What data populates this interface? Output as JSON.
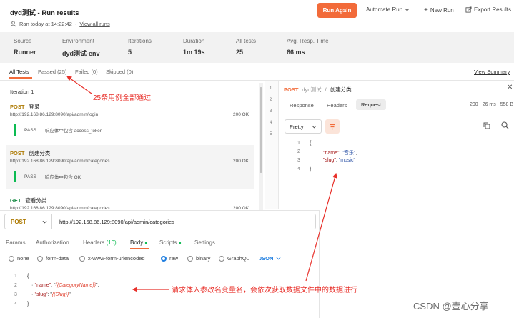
{
  "header": {
    "title": "dyd测试 - Run results",
    "ran_text": "Ran today at 14:22:42",
    "view_all_runs": "View all runs",
    "run_again": "Run Again",
    "automate_run": "Automate Run",
    "new_run": "New Run",
    "export_results": "Export Results"
  },
  "stats": [
    {
      "label": "Source",
      "value": "Runner"
    },
    {
      "label": "Environment",
      "value": "dyd测试-env"
    },
    {
      "label": "Iterations",
      "value": "5"
    },
    {
      "label": "Duration",
      "value": "1m 19s"
    },
    {
      "label": "All tests",
      "value": "25"
    },
    {
      "label": "Avg. Resp. Time",
      "value": "66 ms"
    }
  ],
  "tabs": {
    "all": "All Tests",
    "passed": "Passed (25)",
    "failed": "Failed (0)",
    "skipped": "Skipped (0)",
    "view_summary": "View Summary"
  },
  "results": {
    "iteration": "Iteration 1",
    "items": [
      {
        "method": "POST",
        "name": "登录",
        "url": "http://192.168.86.129:8090/api/admin/login",
        "status": "200 OK",
        "pass": "PASS",
        "test": "响应体中包含 access_token"
      },
      {
        "method": "POST",
        "name": "创建分类",
        "url": "http://192.168.86.129:8090/api/admin/categories",
        "status": "200 OK",
        "pass": "PASS",
        "test": "响应体中包含 OK"
      },
      {
        "method": "GET",
        "name": "查看分类",
        "url": "http://192.168.86.129:8090/api/admin/categories",
        "status": "200 OK"
      }
    ]
  },
  "right_panel": {
    "gutter": [
      "1",
      "2",
      "3",
      "4",
      "5"
    ],
    "method": "POST",
    "collection": "dyd测试",
    "separator": "/",
    "request_name": "创建分类",
    "tabs": [
      "Response",
      "Headers",
      "Request"
    ],
    "status": "200",
    "time": "26 ms",
    "size": "558 B",
    "format": "Pretty",
    "code_lines": [
      "1",
      "2",
      "3",
      "4"
    ],
    "code": {
      "open": "{",
      "name_key": "\"name\"",
      "name_val": "\"音乐\"",
      "slug_key": "\"slug\"",
      "slug_val": "\"music\"",
      "close": "}"
    }
  },
  "bottom_panel": {
    "method": "POST",
    "url": "http://192.168.86.129:8090/api/admin/categories",
    "tabs": {
      "params": "Params",
      "auth": "Authorization",
      "headers": "Headers",
      "headers_count": "(10)",
      "body": "Body",
      "scripts": "Scripts",
      "settings": "Settings"
    },
    "body_types": [
      "none",
      "form-data",
      "x-www-form-urlencoded",
      "raw",
      "binary",
      "GraphQL"
    ],
    "body_format": "JSON",
    "code_lines": [
      "1",
      "2",
      "3",
      "4"
    ],
    "code": {
      "open": "{",
      "name_key": "\"name\"",
      "name_var": "{{CategoryName}}",
      "slug_key": "\"slug\"",
      "slug_var": "{{Slug}}",
      "close": "}"
    }
  },
  "annotations": {
    "passed_note": "25条用例全部通过",
    "body_note": "请求体入参改名变量名，会依次获取数据文件中的数据进行"
  },
  "watermark": "CSDN @壹心分享",
  "colors": {
    "accent": "#f26b3a",
    "pass": "#0cbb52",
    "annotation": "#e8302a",
    "json": "#1f7ee0"
  }
}
